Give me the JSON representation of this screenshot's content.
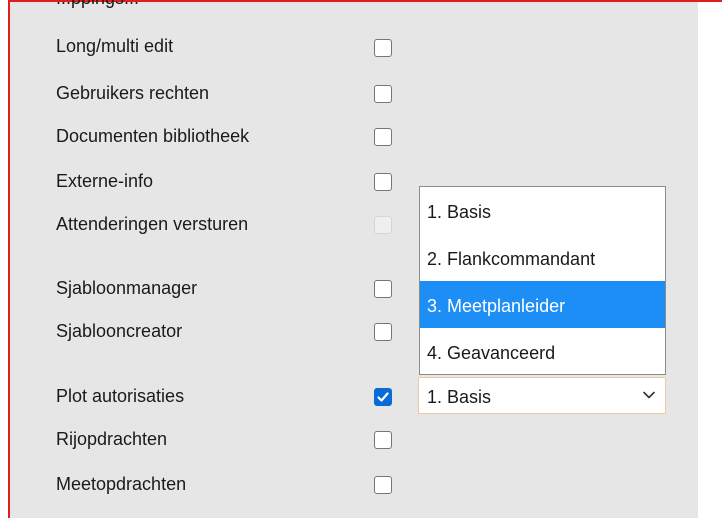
{
  "permissions": {
    "clipped_label": "...ppings...",
    "rows": [
      {
        "label": "Long/multi edit",
        "checked": false,
        "disabled": false
      },
      {
        "label": "Gebruikers rechten",
        "checked": false,
        "disabled": false
      },
      {
        "label": "Documenten bibliotheek",
        "checked": false,
        "disabled": false
      },
      {
        "label": "Externe-info",
        "checked": false,
        "disabled": false
      },
      {
        "label": "Attenderingen versturen",
        "checked": false,
        "disabled": true
      },
      {
        "label": "Sjabloonmanager",
        "checked": false,
        "disabled": false
      },
      {
        "label": "Sjablooncreator",
        "checked": false,
        "disabled": false
      },
      {
        "label": "Plot autorisaties",
        "checked": true,
        "disabled": false
      },
      {
        "label": "Rijopdrachten",
        "checked": false,
        "disabled": false
      },
      {
        "label": "Meetopdrachten",
        "checked": false,
        "disabled": false
      }
    ]
  },
  "plot_level_select": {
    "value": "1. Basis",
    "icon": "chevron-down-icon",
    "options": [
      "1. Basis",
      "2. Flankcommandant",
      "3. Meetplanleider",
      "4. Geavanceerd"
    ],
    "highlighted_option": "3. Meetplanleider"
  },
  "colors": {
    "frame_border": "#e01e1e",
    "panel_bg": "#e6e6e6",
    "checkbox_checked": "#0b6bd6",
    "option_highlight": "#1e8ef7",
    "select_focus_border": "#f1c79d"
  }
}
